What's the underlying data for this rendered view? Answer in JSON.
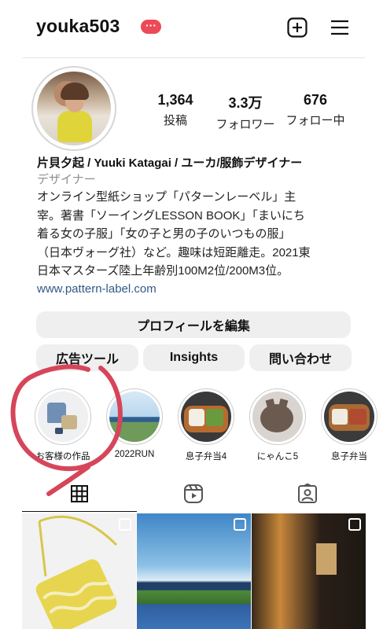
{
  "header": {
    "username": "youka503",
    "notification_badge": "···"
  },
  "stats": [
    {
      "value": "1,364",
      "label": "投稿"
    },
    {
      "value": "3.3万",
      "label": "フォロワー"
    },
    {
      "value": "676",
      "label": "フォロー中"
    }
  ],
  "bio": {
    "name": "片貝夕起 / Yuuki Katagai / ユーカ/服飾デザイナー",
    "category": "デザイナー",
    "lines": [
      "オンライン型紙ショップ「パターンレーベル」主",
      "宰。著書「ソーイングLESSON BOOK」「まいにち",
      "着る女の子服」「女の子と男の子のいつもの服」",
      "（日本ヴォーグ社）など。趣味は短距離走。2021東",
      "日本マスターズ陸上年齢別100M2位/200M3位。"
    ],
    "link": "www.pattern-label.com"
  },
  "buttons": {
    "edit_profile": "プロフィールを編集",
    "ad_tools": "広告ツール",
    "insights": "Insights",
    "contact": "問い合わせ"
  },
  "highlights": [
    {
      "label": "お客様の作品"
    },
    {
      "label": "2022RUN"
    },
    {
      "label": "息子弁当4"
    },
    {
      "label": "にゃんこ5"
    },
    {
      "label": "息子弁当"
    }
  ],
  "tabs": [
    "grid",
    "reels",
    "tagged"
  ],
  "colors": {
    "badge": "#ed4956",
    "link": "#2f5a87",
    "button_bg": "#efefef",
    "annotation": "#d6455a"
  }
}
